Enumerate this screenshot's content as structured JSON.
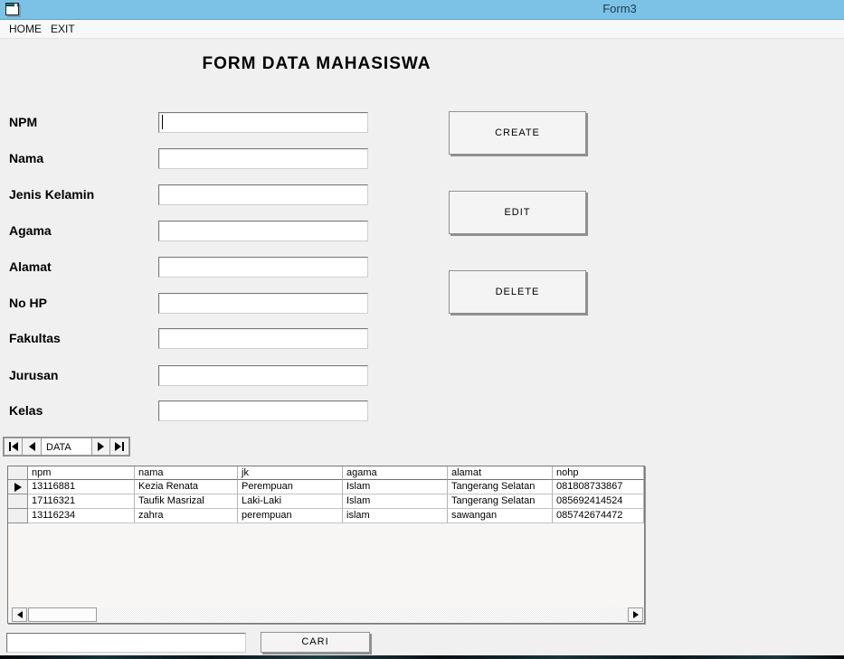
{
  "window": {
    "title": "Form3"
  },
  "menu": {
    "items": [
      {
        "label": "HOME"
      },
      {
        "label": "EXIT"
      }
    ]
  },
  "form": {
    "heading": "FORM DATA MAHASISWA",
    "fields": [
      {
        "label": "NPM",
        "value": ""
      },
      {
        "label": "Nama",
        "value": ""
      },
      {
        "label": "Jenis Kelamin",
        "value": ""
      },
      {
        "label": "Agama",
        "value": ""
      },
      {
        "label": "Alamat",
        "value": ""
      },
      {
        "label": "No HP",
        "value": ""
      },
      {
        "label": "Fakultas",
        "value": ""
      },
      {
        "label": "Jurusan",
        "value": ""
      },
      {
        "label": "Kelas",
        "value": ""
      }
    ],
    "actions": [
      {
        "label": "CREATE"
      },
      {
        "label": "EDIT"
      },
      {
        "label": "DELETE"
      }
    ]
  },
  "data_navigator": {
    "caption": "DATA"
  },
  "grid": {
    "columns": [
      "npm",
      "nama",
      "jk",
      "agama",
      "alamat",
      "nohp"
    ],
    "rows": [
      [
        "13116881",
        "Kezia Renata",
        "Perempuan",
        "Islam",
        "Tangerang Selatan",
        "081808733867"
      ],
      [
        "17116321",
        "Taufik Masrizal",
        "Laki-Laki",
        "Islam",
        "Tangerang Selatan",
        "085692414524"
      ],
      [
        "13116234",
        "zahra",
        "perempuan",
        "islam",
        "sawangan",
        "085742674472"
      ]
    ],
    "current_row_index": 0
  },
  "search": {
    "value": "",
    "button_label": "CARI"
  },
  "colors": {
    "titlebar": "#7cc2e6",
    "form_background": "#f0f0f0",
    "grid_background": "#ffffff",
    "button_shadow": "#8f8f8f"
  }
}
